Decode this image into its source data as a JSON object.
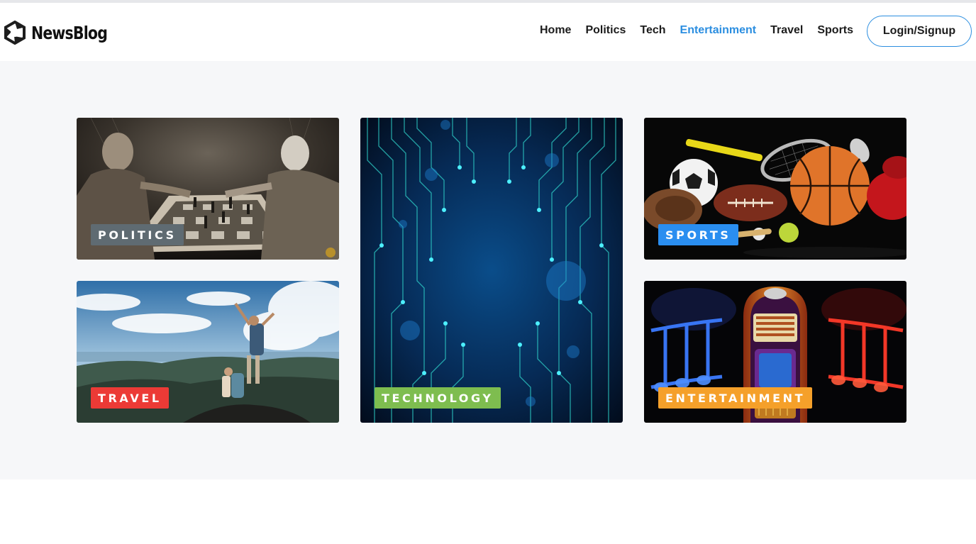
{
  "brand": {
    "name": "NewsBlog"
  },
  "nav": {
    "items": [
      {
        "label": "Home",
        "active": false
      },
      {
        "label": "Politics",
        "active": false
      },
      {
        "label": "Tech",
        "active": false
      },
      {
        "label": "Entertainment",
        "active": true
      },
      {
        "label": "Travel",
        "active": false
      },
      {
        "label": "Sports",
        "active": false
      }
    ],
    "login_label": "Login/Signup"
  },
  "cards": {
    "politics": {
      "label": "POLITICS",
      "badge_color": "#5f6b72"
    },
    "travel": {
      "label": "TRAVEL",
      "badge_color": "#ec3a36"
    },
    "technology": {
      "label": "TECHNOLOGY",
      "badge_color": "#7ebd4f"
    },
    "sports": {
      "label": "SPORTS",
      "badge_color": "#2a8ef0"
    },
    "entertainment": {
      "label": "ENTERTAINMENT",
      "badge_color": "#f5a02a"
    }
  },
  "colors": {
    "accent": "#2b8ee0",
    "section_bg": "#f6f7f9"
  }
}
